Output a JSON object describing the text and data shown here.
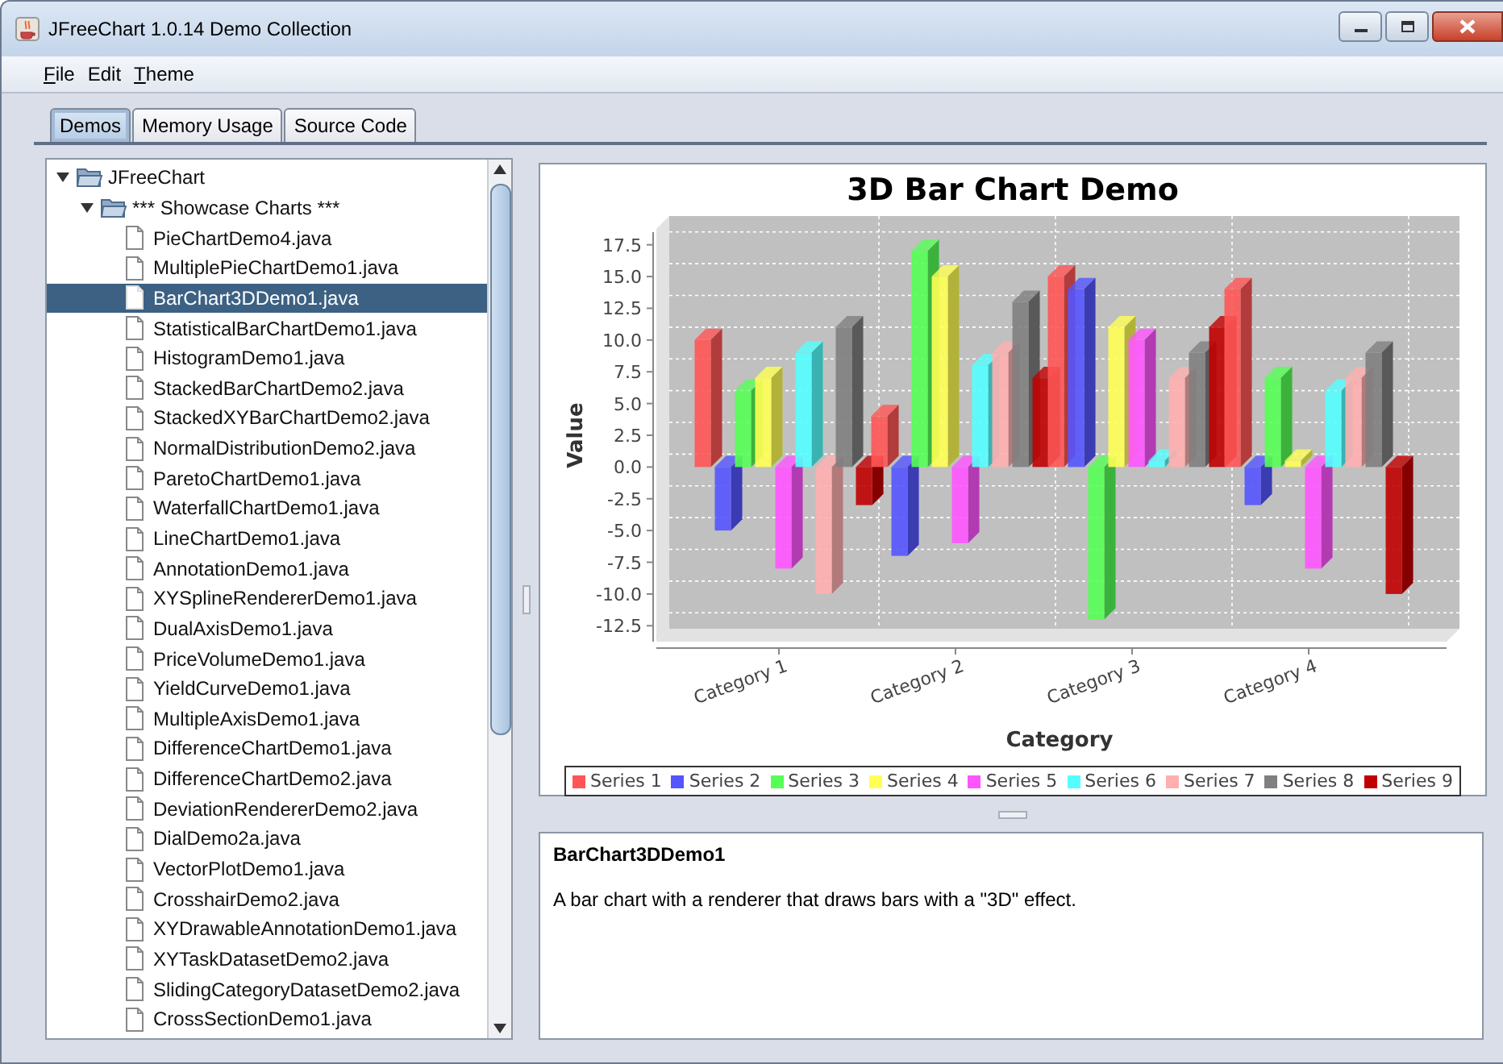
{
  "window": {
    "title": "JFreeChart 1.0.14 Demo Collection"
  },
  "menu": [
    {
      "label": "File",
      "first_letter_underlined": true
    },
    {
      "label": "Edit",
      "first_letter_underlined": false
    },
    {
      "label": "Theme",
      "first_letter_underlined": true
    }
  ],
  "tabs": [
    {
      "label": "Demos",
      "selected": true
    },
    {
      "label": "Memory Usage",
      "selected": false
    },
    {
      "label": "Source Code",
      "selected": false
    }
  ],
  "tree": [
    {
      "label": "JFreeChart",
      "expanded": true,
      "children": [
        {
          "label": "*** Showcase Charts ***",
          "expanded": true,
          "children": [
            {
              "label": "PieChartDemo4.java",
              "selected": false
            },
            {
              "label": "MultiplePieChartDemo1.java",
              "selected": false
            },
            {
              "label": "BarChart3DDemo1.java",
              "selected": true
            },
            {
              "label": "StatisticalBarChartDemo1.java",
              "selected": false
            },
            {
              "label": "HistogramDemo1.java",
              "selected": false
            },
            {
              "label": "StackedBarChartDemo2.java",
              "selected": false
            },
            {
              "label": "StackedXYBarChartDemo2.java",
              "selected": false
            },
            {
              "label": "NormalDistributionDemo2.java",
              "selected": false
            },
            {
              "label": "ParetoChartDemo1.java",
              "selected": false
            },
            {
              "label": "WaterfallChartDemo1.java",
              "selected": false
            },
            {
              "label": "LineChartDemo1.java",
              "selected": false
            },
            {
              "label": "AnnotationDemo1.java",
              "selected": false
            },
            {
              "label": "XYSplineRendererDemo1.java",
              "selected": false
            },
            {
              "label": "DualAxisDemo1.java",
              "selected": false
            },
            {
              "label": "PriceVolumeDemo1.java",
              "selected": false
            },
            {
              "label": "YieldCurveDemo1.java",
              "selected": false
            },
            {
              "label": "MultipleAxisDemo1.java",
              "selected": false
            },
            {
              "label": "DifferenceChartDemo1.java",
              "selected": false
            },
            {
              "label": "DifferenceChartDemo2.java",
              "selected": false
            },
            {
              "label": "DeviationRendererDemo2.java",
              "selected": false
            },
            {
              "label": "DialDemo2a.java",
              "selected": false
            },
            {
              "label": "VectorPlotDemo1.java",
              "selected": false
            },
            {
              "label": "CrosshairDemo2.java",
              "selected": false
            },
            {
              "label": "XYDrawableAnnotationDemo1.java",
              "selected": false
            },
            {
              "label": "XYTaskDatasetDemo2.java",
              "selected": false
            },
            {
              "label": "SlidingCategoryDatasetDemo2.java",
              "selected": false
            },
            {
              "label": "CrossSectionDemo1.java",
              "selected": false
            }
          ]
        }
      ]
    }
  ],
  "chart": {
    "chart_data": {
      "type": "bar",
      "title": "3D Bar Chart Demo",
      "xlabel": "Category",
      "ylabel": "Value",
      "categories": [
        "Category 1",
        "Category 2",
        "Category 3",
        "Category 4"
      ],
      "ylim": [
        -13.75,
        18.75
      ],
      "legend": true,
      "yticks": [
        {
          "value": -12.5,
          "label": "-12.5"
        },
        {
          "value": -10,
          "label": "-10.0"
        },
        {
          "value": -7.5,
          "label": "-7.5"
        },
        {
          "value": -5,
          "label": "-5.0"
        },
        {
          "value": -2.5,
          "label": "-2.5"
        },
        {
          "value": 0,
          "label": "0.0"
        },
        {
          "value": 2.5,
          "label": "2.5"
        },
        {
          "value": 5,
          "label": "5.0"
        },
        {
          "value": 7.5,
          "label": "7.5"
        },
        {
          "value": 10,
          "label": "10.0"
        },
        {
          "value": 12.5,
          "label": "12.5"
        },
        {
          "value": 15,
          "label": "15.0"
        },
        {
          "value": 17.5,
          "label": "17.5"
        }
      ],
      "series": [
        {
          "name": "Series 1",
          "color": "#ff5555",
          "values": [
            10,
            4,
            15,
            14
          ]
        },
        {
          "name": "Series 2",
          "color": "#5555ff",
          "values": [
            -5,
            -7,
            14,
            -3
          ]
        },
        {
          "name": "Series 3",
          "color": "#55ff55",
          "values": [
            6,
            17,
            -12,
            7
          ]
        },
        {
          "name": "Series 4",
          "color": "#ffff55",
          "values": [
            7,
            15,
            11,
            0.5
          ]
        },
        {
          "name": "Series 5",
          "color": "#ff55ff",
          "values": [
            -8,
            -6,
            10,
            -8
          ]
        },
        {
          "name": "Series 6",
          "color": "#55ffff",
          "values": [
            9,
            8,
            0.5,
            6
          ]
        },
        {
          "name": "Series 7",
          "color": "#ffafaf",
          "values": [
            -10,
            9,
            7,
            7
          ]
        },
        {
          "name": "Series 8",
          "color": "#808080",
          "values": [
            11,
            13,
            9,
            9
          ]
        },
        {
          "name": "Series 9",
          "color": "#c00000",
          "values": [
            -3,
            7,
            11,
            -10
          ]
        }
      ]
    }
  },
  "description": {
    "title": "BarChart3DDemo1",
    "text": "A bar chart with a renderer that draws bars with a \"3D\" effect."
  }
}
